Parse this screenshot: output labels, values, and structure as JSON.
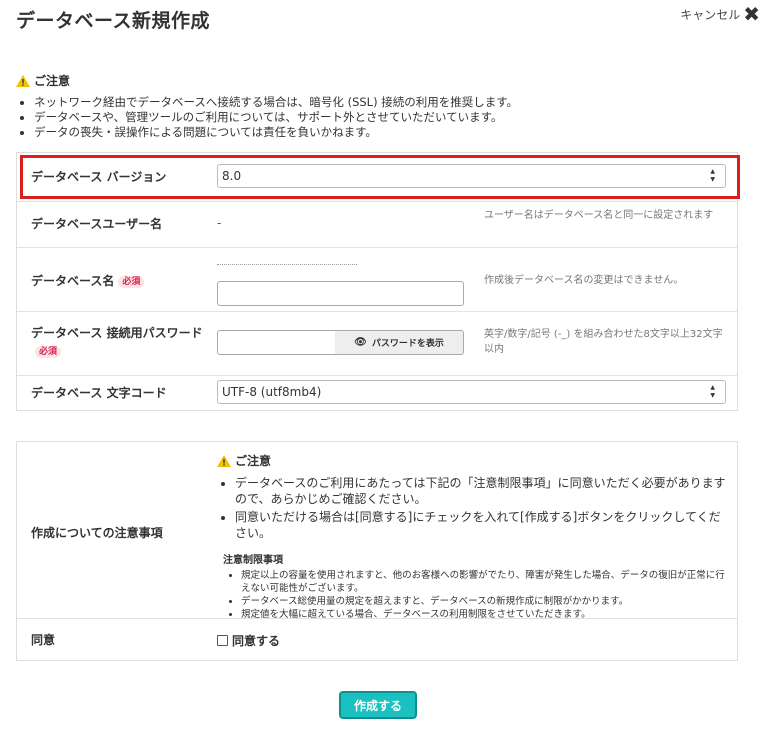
{
  "title": "データベース新規作成",
  "cancel_label": "キャンセル",
  "notice": {
    "heading": "ご注意",
    "items": [
      "ネットワーク経由でデータベースへ接続する場合は、暗号化 (SSL) 接続の利用を推奨します。",
      "データベースや、管理ツールのご利用については、サポート外とさせていただいています。",
      "データの喪失・誤操作による問題については責任を負いかねます。"
    ]
  },
  "form": {
    "version_label": "データベース バージョン",
    "version_value": "8.0",
    "user_label": "データベースユーザー名",
    "user_value": "-",
    "user_hint": "ユーザー名はデータベース名と同一に設定されます",
    "name_label": "データベース名",
    "required_badge": "必須",
    "name_hint": "作成後データベース名の変更はできません。",
    "password_label": "データベース 接続用パスワード",
    "password_button": "パスワードを表示",
    "password_hint": "英字/数字/記号 (-_) を組み合わせた8文字以上32文字以内",
    "charset_label": "データベース 文字コード",
    "charset_value": "UTF-8 (utf8mb4)"
  },
  "terms": {
    "row_label": "作成についての注意事項",
    "heading": "ご注意",
    "items": [
      "データベースのご利用にあたっては下記の「注意制限事項」に同意いただく必要がありますので、あらかじめご確認ください。",
      "同意いただける場合は[同意する]にチェックを入れて[作成する]ボタンをクリックしてください。"
    ],
    "restrictions_heading": "注意制限事項",
    "restrictions": [
      "規定以上の容量を使用されますと、他のお客様への影響がでたり、障害が発生した場合、データの復旧が正常に行えない可能性がございます。",
      "データベース総使用量の規定を超えますと、データベースの新規作成に制限がかかります。",
      "規定値を大幅に超えている場合、データベースの利用制限をさせていただきます。"
    ]
  },
  "agree": {
    "row_label": "同意",
    "checkbox_label": "同意する"
  },
  "submit_label": "作成する",
  "colors": {
    "highlight": "#d9201f",
    "submit": "#1bc1c1",
    "required": "#d9254f"
  }
}
